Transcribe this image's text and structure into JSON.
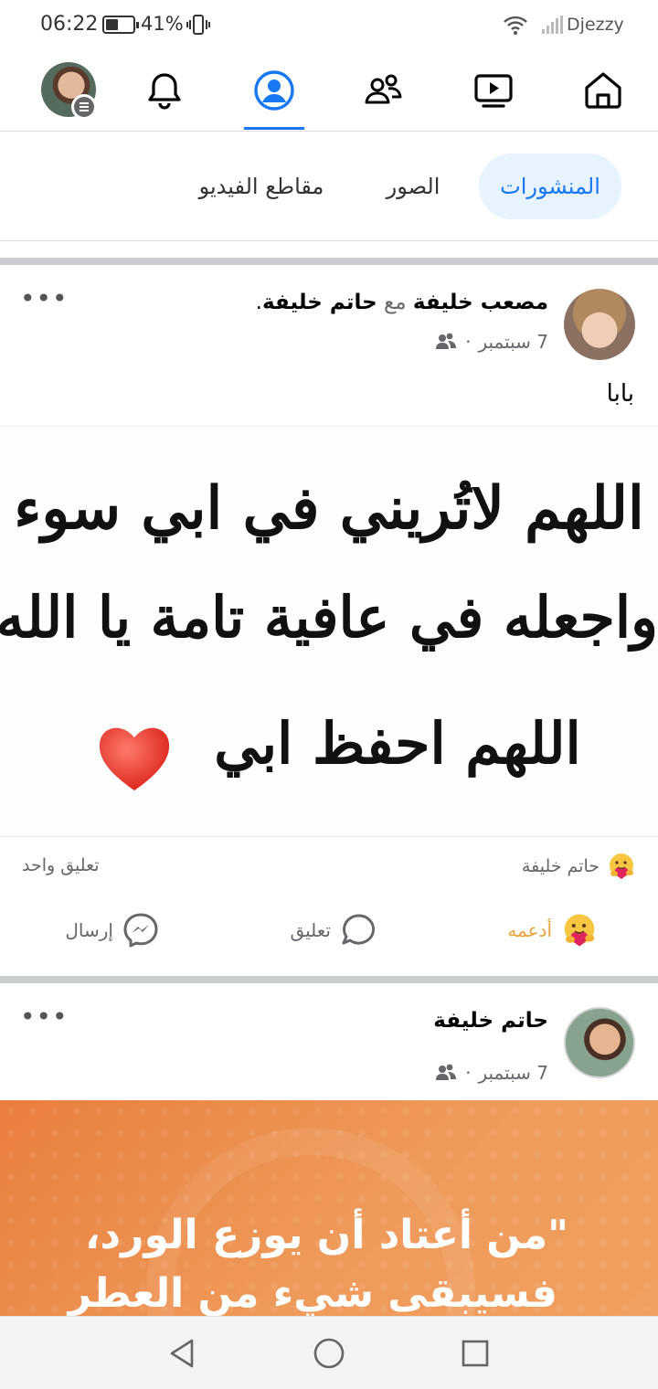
{
  "status_bar": {
    "time": "06:22",
    "battery_pct": "41%",
    "carrier": "Djezzy"
  },
  "top_nav": {
    "items": [
      "avatar-menu",
      "notifications",
      "profile",
      "friends",
      "watch",
      "home"
    ],
    "active": "profile"
  },
  "filters": {
    "posts": "المنشورات",
    "photos": "الصور",
    "videos": "مقاطع الفيديو"
  },
  "post1": {
    "author": "مصعب خليفة",
    "with_word": "مع",
    "tagged": "حاتم خليفة",
    "tag_end": ".",
    "date": "7 سبتمبر",
    "separator": "·",
    "text": "بابا",
    "image_lines": [
      "اللهم لاتُريني في ابي سوء",
      "واجعله في عافية تامة يا الله",
      "اللهم احفظ ابي"
    ],
    "reaction_name": "حاتم خليفة",
    "comment_count": "تعليق واحد",
    "actions": {
      "support": "أدعمه",
      "comment": "تعليق",
      "send": "إرسال"
    }
  },
  "post2": {
    "author": "حاتم خليفة",
    "date": "7 سبتمبر",
    "separator": "·",
    "quote_lines": [
      "\"من أعتاد أن يوزع الورد،",
      "فسيبقى شيء من العطر"
    ]
  },
  "colors": {
    "accent": "#1877f2",
    "support": "#e8a33d",
    "card_orange": "#e97e3d"
  }
}
